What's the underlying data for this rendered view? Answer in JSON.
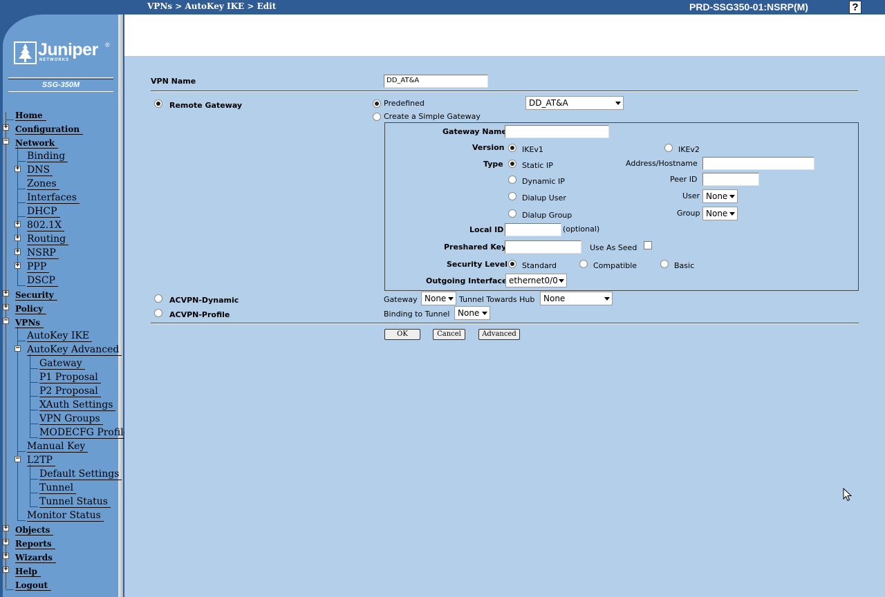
{
  "header": {
    "breadcrumb": "VPNs > AutoKey IKE > Edit",
    "device": "PRD-SSG350-01:NSRP(M)",
    "help_label": "?"
  },
  "sidebar": {
    "logo_text": "Juniper",
    "logo_sub": "NETWORKS",
    "logo_mark": "®",
    "model": "SSG-350M",
    "nav": {
      "home": "Home",
      "configuration": "Configuration",
      "network": "Network",
      "binding": "Binding",
      "dns": "DNS",
      "zones": "Zones",
      "interfaces": "Interfaces",
      "dhcp": "DHCP",
      "dot1x": "802.1X",
      "routing": "Routing",
      "nsrp": "NSRP",
      "ppp": "PPP",
      "dscp": "DSCP",
      "security": "Security",
      "policy": "Policy",
      "vpns": "VPNs",
      "autokey_ike": "AutoKey IKE",
      "autokey_advanced": "AutoKey Advanced",
      "gateway": "Gateway",
      "p1_proposal": "P1 Proposal",
      "p2_proposal": "P2 Proposal",
      "xauth_settings": "XAuth Settings",
      "vpn_groups": "VPN Groups",
      "modecfg_profile": "MODECFG Profile",
      "manual_key": "Manual Key",
      "l2tp": "L2TP",
      "default_settings": "Default Settings",
      "tunnel": "Tunnel",
      "tunnel_status": "Tunnel Status",
      "monitor_status": "Monitor Status",
      "objects": "Objects",
      "reports": "Reports",
      "wizards": "Wizards",
      "help": "Help",
      "logout": "Logout"
    }
  },
  "form": {
    "vpn_name_label": "VPN Name",
    "vpn_name_value": "DD_AT&A",
    "remote_gateway_label": "Remote Gateway",
    "predefined_label": "Predefined",
    "predefined_value": "DD_AT&A",
    "create_simple_label": "Create a Simple Gateway",
    "gateway_name_label": "Gateway Name",
    "version_label": "Version",
    "ikev1_label": "IKEv1",
    "ikev2_label": "IKEv2",
    "type_label": "Type",
    "static_ip_label": "Static IP",
    "address_hostname_label": "Address/Hostname",
    "dynamic_ip_label": "Dynamic IP",
    "peer_id_label": "Peer ID",
    "dialup_user_label": "Dialup User",
    "user_label": "User",
    "user_value": "None",
    "dialup_group_label": "Dialup Group",
    "group_label": "Group",
    "group_value": "None",
    "local_id_label": "Local ID",
    "optional_note": "(optional)",
    "preshared_key_label": "Preshared Key",
    "use_as_seed_label": "Use As Seed",
    "security_level_label": "Security Level",
    "standard_label": "Standard",
    "compatible_label": "Compatible",
    "basic_label": "Basic",
    "outgoing_interface_label": "Outgoing Interface",
    "outgoing_interface_value": "ethernet0/0",
    "acvpn_dynamic_label": "ACVPN-Dynamic",
    "gateway_label": "Gateway",
    "gateway_value": "None",
    "tunnel_towards_hub_label": "Tunnel Towards Hub",
    "tunnel_towards_hub_value": "None",
    "acvpn_profile_label": "ACVPN-Profile",
    "binding_to_tunnel_label": "Binding to Tunnel",
    "binding_to_tunnel_value": "None"
  },
  "buttons": {
    "ok": "OK",
    "cancel": "Cancel",
    "advanced": "Advanced"
  },
  "colors": {
    "header_bg": "#2f5c94",
    "sidebar_bg": "#6b9dd1",
    "content_bg": "#b4cfe9"
  }
}
